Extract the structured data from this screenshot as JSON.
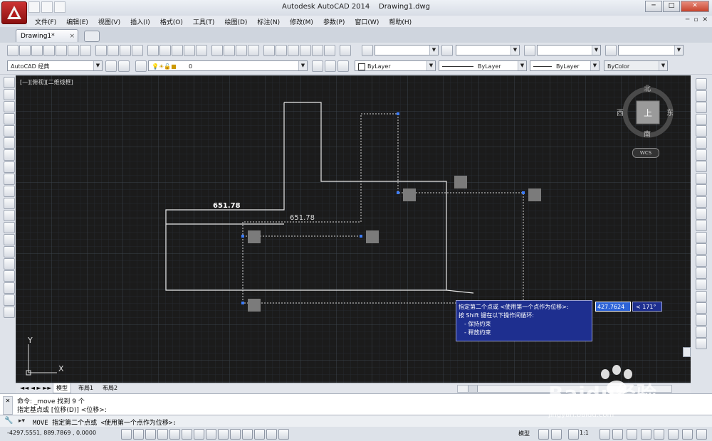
{
  "app": {
    "title": "Autodesk AutoCAD 2014",
    "document": "Drawing1.dwg"
  },
  "window_controls": {
    "minimize": "─",
    "maximize": "□",
    "close": "✕"
  },
  "menu": [
    "文件(F)",
    "编辑(E)",
    "视图(V)",
    "插入(I)",
    "格式(O)",
    "工具(T)",
    "绘图(D)",
    "标注(N)",
    "修改(M)",
    "参数(P)",
    "窗口(W)",
    "帮助(H)"
  ],
  "mdi_controls": {
    "minimize": "─",
    "restore": "▫",
    "close": "✕"
  },
  "tab": {
    "label": "Drawing1*",
    "close": "×"
  },
  "toolbars": {
    "workspace": "AutoCAD 经典",
    "layer": "0",
    "color": "ByLayer",
    "linetype": "ByLayer",
    "lineweight": "ByLayer",
    "plotstyle": "ByColor"
  },
  "viewport": {
    "label": "[—][俯视][二维线框]",
    "compass": {
      "north": "北",
      "south": "南",
      "east": "东",
      "west": "西",
      "top": "上"
    },
    "wcs": "WCS",
    "dim_text_original": "651.78",
    "dim_text_preview": "651.78",
    "ucs_x": "X",
    "ucs_y": "Y"
  },
  "tooltip": {
    "line1": "指定第二个点或 <使用第一个点作为位移>:",
    "line2": "按 Shift 键在以下操作间循环:",
    "line3": "- 保持约束",
    "line4": "- 释放约束"
  },
  "dynamic_input": {
    "distance": "427.7624",
    "angle": "< 171°"
  },
  "layout_tabs": [
    "模型",
    "布局1",
    "布局2"
  ],
  "command": {
    "history1": "命令: _move 找到 9 个",
    "history2": "指定基点或 [位移(D)] <位移>:",
    "prompt": "MOVE 指定第二个点或 <使用第一个点作为位移>:"
  },
  "status": {
    "coords": "-4297.5551, 889.7869 , 0.0000",
    "model": "模型",
    "scale": "1:1"
  },
  "watermark": {
    "brand": "Baidu经验",
    "url": "jingyan.baidu.com"
  }
}
